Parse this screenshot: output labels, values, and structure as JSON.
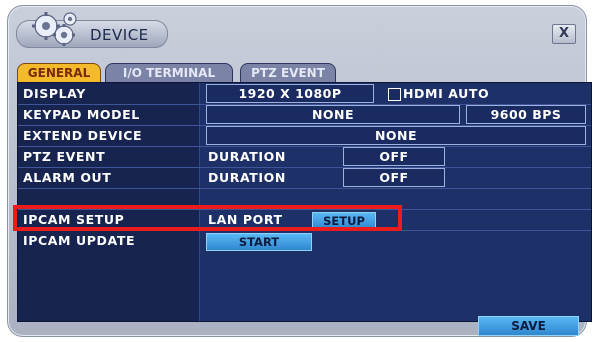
{
  "window": {
    "title": "DEVICE",
    "close_glyph": "X",
    "icon": "gears-icon"
  },
  "tabs": [
    {
      "label": "GENERAL",
      "active": true
    },
    {
      "label": "I/O TERMINAL",
      "active": false
    },
    {
      "label": "PTZ EVENT",
      "active": false
    }
  ],
  "rows": {
    "display": {
      "label": "DISPLAY",
      "resolution": "1920 X 1080P",
      "hdmi_auto_label": "HDMI AUTO",
      "hdmi_auto_checked": false
    },
    "keypad_model": {
      "label": "KEYPAD MODEL",
      "model": "NONE",
      "baud": "9600 BPS"
    },
    "extend_device": {
      "label": "EXTEND DEVICE",
      "value": "NONE"
    },
    "ptz_event": {
      "label": "PTZ EVENT",
      "sub_label": "DURATION",
      "value": "OFF"
    },
    "alarm_out": {
      "label": "ALARM OUT",
      "sub_label": "DURATION",
      "value": "OFF"
    },
    "ipcam_setup": {
      "label": "IPCAM SETUP",
      "sub_label": "LAN PORT",
      "button": "SETUP"
    },
    "ipcam_update": {
      "label": "IPCAM UPDATE",
      "button": "START"
    }
  },
  "footer": {
    "save_label": "SAVE"
  },
  "colors": {
    "accent_tab": "#f3ba2c",
    "panel_bg": "#1b2a5e",
    "button_blue": "#3b9be0",
    "highlight": "#ea1c1c"
  }
}
